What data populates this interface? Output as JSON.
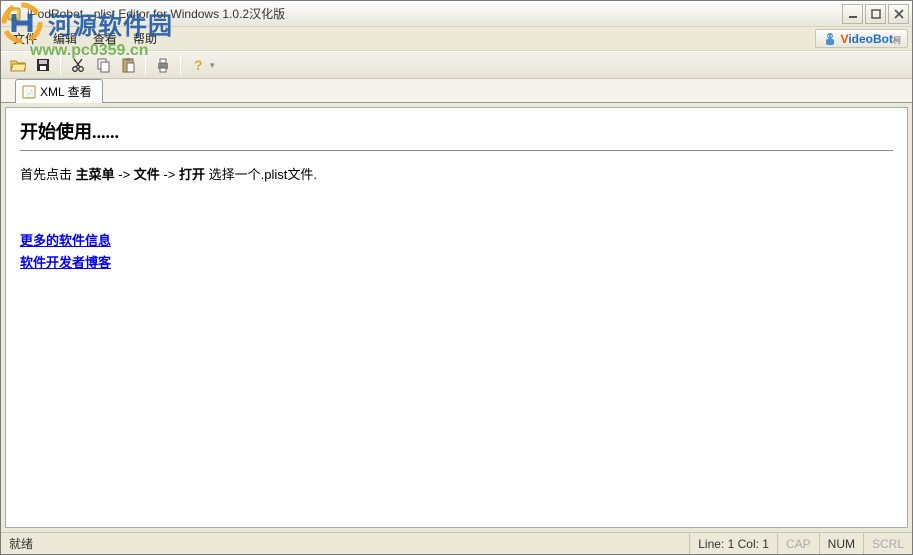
{
  "title": "iPodRobot - plist Editor for Windows 1.0.2汉化版",
  "menubar": {
    "file": "文件",
    "edit": "编辑",
    "view": "查看",
    "help": "帮助"
  },
  "videobot": {
    "v": "V",
    "rest": "ideoBot",
    "sub": "柯"
  },
  "toolbar_icons": {
    "open": "open-icon",
    "save": "save-icon",
    "cut": "cut-icon",
    "copy": "copy-icon",
    "paste": "paste-icon",
    "print": "print-icon",
    "help": "help-icon"
  },
  "tab": {
    "label": "XML 查看"
  },
  "content": {
    "heading": "开始使用......",
    "intro_pre": "首先点击 ",
    "intro_b1": "主菜单",
    "intro_arrow": " -> ",
    "intro_b2": "文件",
    "intro_b3": "打开",
    "intro_post": " 选择一个.plist文件.",
    "link1": "更多的软件信息",
    "link2": "软件开发者博客"
  },
  "statusbar": {
    "ready": "就绪",
    "pos": "Line: 1 Col: 1",
    "cap": "CAP",
    "num": "NUM",
    "scrl": "SCRL"
  },
  "watermark": {
    "brand_cn": "河源软件园",
    "url": "www.pc0359.cn"
  }
}
